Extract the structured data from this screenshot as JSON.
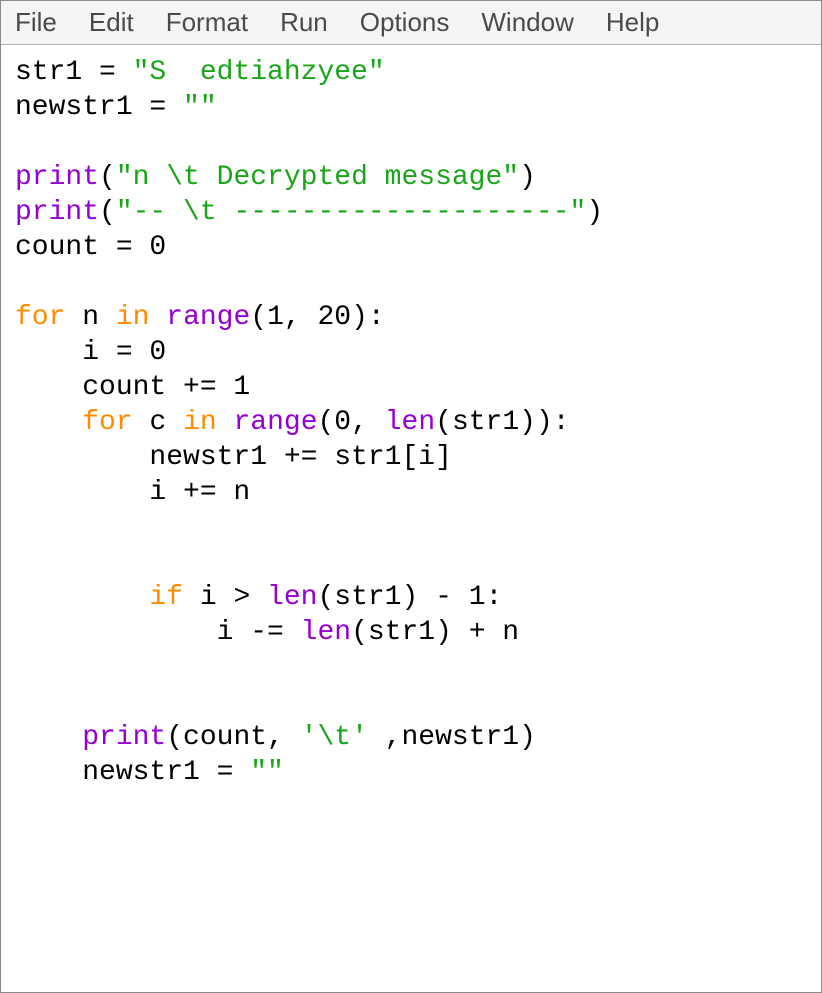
{
  "menu": {
    "file": "File",
    "edit": "Edit",
    "format": "Format",
    "run": "Run",
    "options": "Options",
    "window": "Window",
    "help": "Help"
  },
  "code": {
    "l01_a": "str1 = ",
    "l01_b": "\"S  edtiahzyee\"",
    "l02_a": "newstr1 = ",
    "l02_b": "\"\"",
    "l03": "",
    "l04_a": "print",
    "l04_b": "(",
    "l04_c": "\"n \\t Decrypted message\"",
    "l04_d": ")",
    "l05_a": "print",
    "l05_b": "(",
    "l05_c": "\"-- \\t --------------------\"",
    "l05_d": ")",
    "l06": "count = 0",
    "l07": "",
    "l08_a": "for",
    "l08_b": " n ",
    "l08_c": "in",
    "l08_d": " ",
    "l08_e": "range",
    "l08_f": "(1, 20):",
    "l09": "    i = 0",
    "l10": "    count += 1",
    "l11_a": "    ",
    "l11_b": "for",
    "l11_c": " c ",
    "l11_d": "in",
    "l11_e": " ",
    "l11_f": "range",
    "l11_g": "(0, ",
    "l11_h": "len",
    "l11_i": "(str1)):",
    "l12": "        newstr1 += str1[i]",
    "l13": "        i += n",
    "l14": "",
    "l15": "",
    "l16_a": "        ",
    "l16_b": "if",
    "l16_c": " i > ",
    "l16_d": "len",
    "l16_e": "(str1) - 1:",
    "l17_a": "            i -= ",
    "l17_b": "len",
    "l17_c": "(str1) + n",
    "l18": "",
    "l19": "",
    "l20_a": "    ",
    "l20_b": "print",
    "l20_c": "(count, ",
    "l20_d": "'\\t'",
    "l20_e": " ,newstr1)",
    "l21_a": "    newstr1 = ",
    "l21_b": "\"\""
  }
}
